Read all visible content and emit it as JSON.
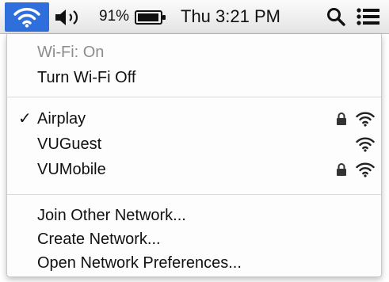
{
  "menubar": {
    "wifi_icon": "wifi-icon",
    "volume_icon": "volume-icon",
    "battery_percent": "91%",
    "battery_icon": "battery-icon",
    "clock": "Thu 3:21 PM",
    "search_icon": "spotlight-search-icon",
    "notification_icon": "notification-center-icon",
    "accent_color": "#2f6fdc"
  },
  "wifi_menu": {
    "status": "Wi-Fi: On",
    "toggle": "Turn Wi-Fi Off",
    "networks": [
      {
        "name": "Airplay",
        "selected": true,
        "check": "✓",
        "secured": true
      },
      {
        "name": "VUGuest",
        "selected": false,
        "check": "",
        "secured": false
      },
      {
        "name": "VUMobile",
        "selected": false,
        "check": "",
        "secured": true
      }
    ],
    "actions": {
      "join_other": "Join Other Network...",
      "create": "Create Network...",
      "open_prefs": "Open Network Preferences..."
    }
  }
}
